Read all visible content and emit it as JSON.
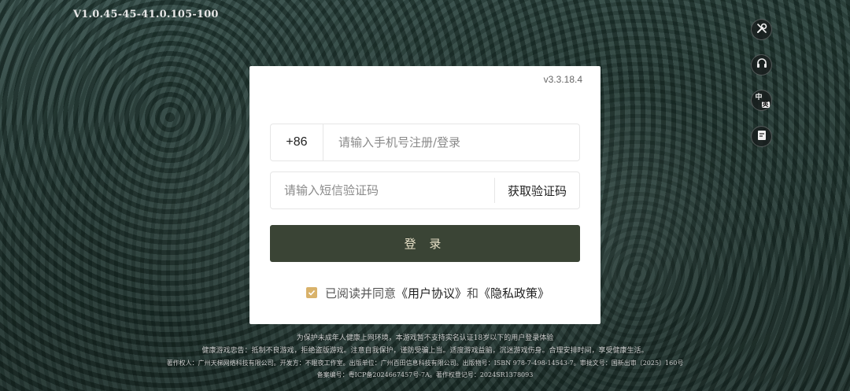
{
  "app": {
    "build_version": "V1.0.45-45-41.0.105-100",
    "card_version": "v3.3.18.4"
  },
  "side_buttons": [
    {
      "icon": "tools-icon"
    },
    {
      "icon": "headset-icon"
    },
    {
      "icon": "language-icon",
      "glyph_zh": "中",
      "glyph_en": "英"
    },
    {
      "icon": "notice-icon"
    }
  ],
  "login": {
    "country_code": "+86",
    "phone_placeholder": "请输入手机号注册/登录",
    "code_placeholder": "请输入短信验证码",
    "get_code_label": "获取验证码",
    "submit_label": "登 录",
    "agree_prefix": "已阅读并同意",
    "user_agreement": "《用户协议》",
    "and": "和",
    "privacy_policy": "《隐私政策》",
    "agreed": true
  },
  "footer": {
    "line1": "为保护未成年人健康上网环境，本游戏暂不支持实名认证18岁以下的用户登录体验",
    "line2": "健康游戏忠告：抵制不良游戏，拒绝盗版游戏。注意自我保护，谨防受骗上当。适度游戏益脑，沉迷游戏伤身。合理安排时间，享受健康生活。",
    "line3": "著作权人：广州天梯网络科技有限公司。开发方：不眠夜工作室。出版单位：广州百田信息科技有限公司。出版物号：ISBN 978-7-498-14543-7。审批文号：国新出审〔2025〕160号",
    "line4": "备案编号：粤ICP备2024667457号-7A。著作权登记号：2024SR1378093"
  },
  "colors": {
    "login_button": "#3a4435",
    "checkbox": "#d9b26a"
  }
}
